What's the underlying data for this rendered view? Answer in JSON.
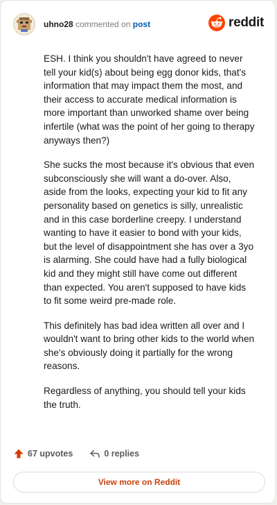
{
  "header": {
    "username": "uhno28",
    "action_text": "commented on",
    "post_link": "post",
    "brand": "reddit"
  },
  "comment": {
    "paragraphs": [
      "ESH. I think you shouldn't have agreed to never tell your kid(s) about being egg donor kids, that's information that may impact them the most, and their access to accurate medical information is more important than unworked shame over being infertile (what was the point of her going to therapy anyways then?)",
      "She sucks the most because it's obvious that even subconsciously she will want a do-over. Also, aside from the looks, expecting your kid to fit any personality based on genetics is silly, unrealistic and in this case borderline creepy. I understand wanting to have it easier to bond with your kids, but the level of disappointment she has over a 3yo is alarming. She could have had a fully biological kid and they might still have come out different than expected. You aren't supposed to have kids to fit some weird pre-made role.",
      "This definitely has bad idea written all over and I wouldn't want to bring other kids to the world when she's obviously doing it partially for the wrong reasons.",
      "Regardless of anything, you should tell your kids the truth."
    ]
  },
  "footer": {
    "upvotes": "67 upvotes",
    "replies": "0 replies",
    "view_more": "View more on Reddit"
  },
  "colors": {
    "brand_orange": "#ff4500",
    "upvote_orange": "#d93a00",
    "link_blue": "#0b5ea8",
    "view_more_text": "#c9410f"
  },
  "icons": {
    "avatar": "pixel-avatar-icon",
    "logo": "reddit-snoo-icon",
    "upvote": "upvote-arrow-icon",
    "reply": "reply-arrow-icon"
  }
}
